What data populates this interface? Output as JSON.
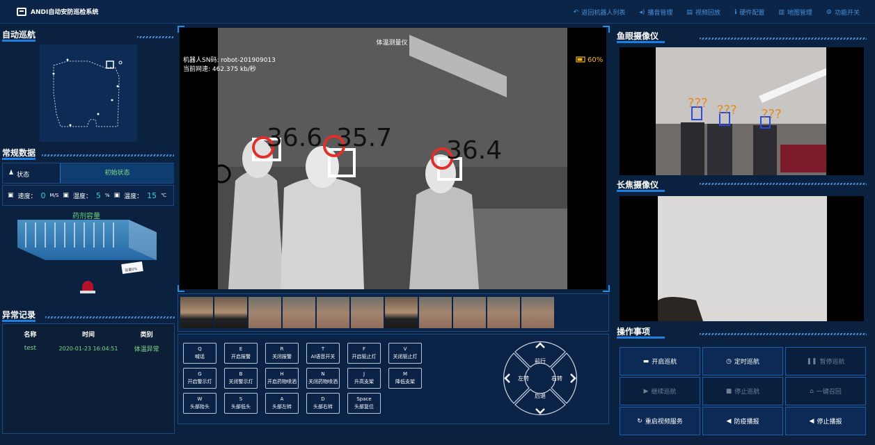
{
  "app": {
    "title": "ANDI自动安防巡检系统"
  },
  "nav": [
    {
      "label": "返回机器人列表",
      "icon": "back-arrow-icon"
    },
    {
      "label": "播音管理",
      "icon": "speaker-icon"
    },
    {
      "label": "视频回放",
      "icon": "film-icon"
    },
    {
      "label": "硬件配置",
      "icon": "info-icon"
    },
    {
      "label": "地图管理",
      "icon": "map-icon"
    },
    {
      "label": "功能开关",
      "icon": "gear-icon"
    }
  ],
  "sections": {
    "auto_nav": "自动巡航",
    "routine_data": "常规数据",
    "abnormal_records": "异常记录",
    "fisheye_camera": "鱼眼摄像仪",
    "telephoto_camera": "长焦摄像仪",
    "operations": "操作事项"
  },
  "routine": {
    "state_label": "状态",
    "state_value": "初始状态",
    "speed_label": "速度：",
    "speed_value": "0",
    "speed_unit": "M/S",
    "humidity_label": "湿度：",
    "humidity_value": "5",
    "humidity_unit": "%",
    "temp_label": "温度：",
    "temp_value": "15",
    "temp_unit": "℃",
    "tank_label": "药剂容量",
    "tank_card": "容量0%"
  },
  "abnormal": {
    "headers": [
      "名称",
      "时间",
      "类别"
    ],
    "rows": [
      {
        "name": "test",
        "time": "2020-01-23 16:04:51",
        "category": "体温异常"
      }
    ]
  },
  "video": {
    "title": "体温测量仪",
    "sn": "机器人SN码: robot-201909013",
    "speed": "当前网速: 462.375 kb/秒",
    "battery": "60%",
    "temps": [
      "36.6",
      "35.7",
      "36.4"
    ]
  },
  "fisheye": {
    "marks": [
      "???",
      "???",
      "???"
    ]
  },
  "keys": [
    {
      "key": "Q",
      "label": "喊话"
    },
    {
      "key": "E",
      "label": "开启报警"
    },
    {
      "key": "R",
      "label": "关闭报警"
    },
    {
      "key": "T",
      "label": "AI语音开关"
    },
    {
      "key": "F",
      "label": "开启驱止灯"
    },
    {
      "key": "V",
      "label": "关闭驱止灯"
    },
    {
      "key": "G",
      "label": "开启警示灯"
    },
    {
      "key": "B",
      "label": "关闭警示灯"
    },
    {
      "key": "H",
      "label": "开启药物喷洒"
    },
    {
      "key": "N",
      "label": "关闭药物喷洒"
    },
    {
      "key": "J",
      "label": "升高支架"
    },
    {
      "key": "M",
      "label": "降低支架"
    },
    {
      "key": "W",
      "label": "头部抬头"
    },
    {
      "key": "S",
      "label": "头部低头"
    },
    {
      "key": "A",
      "label": "头部左转"
    },
    {
      "key": "D",
      "label": "头部右转"
    },
    {
      "key": "Space",
      "label": "头部复位"
    }
  ],
  "dpad": {
    "forward": "前行",
    "left": "左转",
    "right": "右转",
    "back": "后退"
  },
  "ops": [
    {
      "label": "开启巡航",
      "icon": "nav-icon",
      "enabled": true
    },
    {
      "label": "定时巡航",
      "icon": "clock-icon",
      "enabled": true
    },
    {
      "label": "暂停巡航",
      "icon": "pause-icon",
      "enabled": false
    },
    {
      "label": "继续巡航",
      "icon": "play-icon",
      "enabled": false
    },
    {
      "label": "停止巡航",
      "icon": "stop-icon",
      "enabled": false
    },
    {
      "label": "一键召回",
      "icon": "recall-icon",
      "enabled": false
    },
    {
      "label": "重启视频服务",
      "icon": "refresh-icon",
      "enabled": true
    },
    {
      "label": "防疫播报",
      "icon": "megaphone-icon",
      "enabled": true
    },
    {
      "label": "停止播报",
      "icon": "megaphone-icon",
      "enabled": true
    }
  ]
}
